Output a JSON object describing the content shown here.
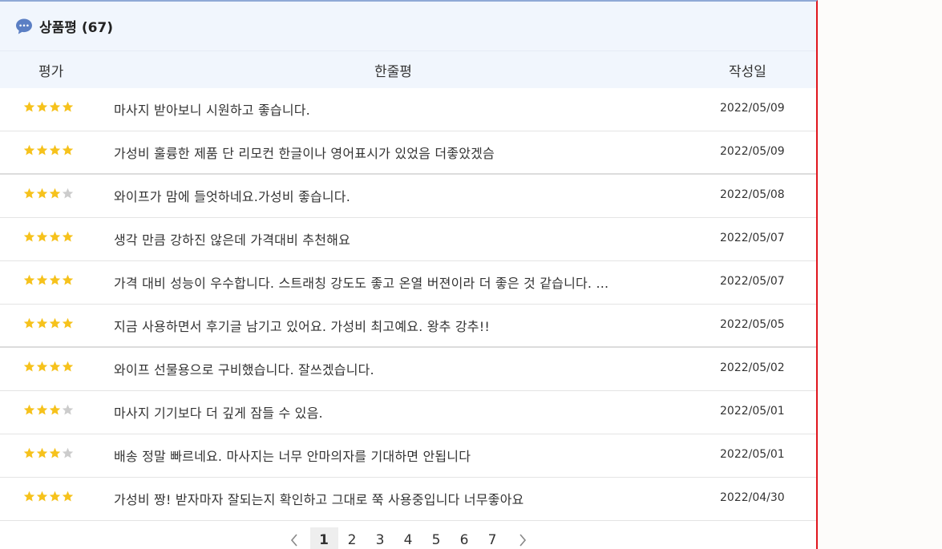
{
  "header": {
    "title": "상품평 (67)",
    "icon": "chat-bubble-icon",
    "accent_color": "#5b7fc4"
  },
  "columns": {
    "rating": "평가",
    "review": "한줄평",
    "date": "작성일"
  },
  "reviews": [
    {
      "stars": 4,
      "text": "마사지 받아보니 시원하고 좋습니다.",
      "date": "2022/05/09"
    },
    {
      "stars": 4,
      "text": "가성비 훌륭한 제품 단 리모컨 한글이나 영어표시가 있었음 더좋았겠슴",
      "date": "2022/05/09"
    },
    {
      "stars": 3,
      "text": "와이프가 맘에 들엇하네요.가성비 좋습니다.",
      "date": "2022/05/08"
    },
    {
      "stars": 4,
      "text": "생각 만큼 강하진 않은데 가격대비 추천해요",
      "date": "2022/05/07"
    },
    {
      "stars": 4,
      "text": "가격 대비 성능이 우수합니다. 스트래칭 강도도 좋고 온열 버젼이라 더 좋은 것 같습니다. ...",
      "date": "2022/05/07"
    },
    {
      "stars": 4,
      "text": "지금 사용하면서 후기글 남기고 있어요. 가성비 최고예요. 왕추 강추!!",
      "date": "2022/05/05"
    },
    {
      "stars": 4,
      "text": "와이프 선물용으로 구비했습니다. 잘쓰겠습니다.",
      "date": "2022/05/02"
    },
    {
      "stars": 3,
      "text": "마사지 기기보다 더 깊게 잠들 수 있음.",
      "date": "2022/05/01"
    },
    {
      "stars": 3,
      "text": "배송 정말 빠르네요. 마사지는 너무 안마의자를 기대하면 안됩니다",
      "date": "2022/05/01"
    },
    {
      "stars": 4,
      "text": "가성비 짱! 받자마자 잘되는지 확인하고 그대로 쭉 사용중입니다 너무좋아요",
      "date": "2022/04/30"
    }
  ],
  "star_colors": {
    "filled": "#f6c21c",
    "empty": "#cccccc"
  },
  "pagination": {
    "pages": [
      "1",
      "2",
      "3",
      "4",
      "5",
      "6",
      "7"
    ],
    "current": "1",
    "prev_icon": "chevron-left-icon",
    "next_icon": "chevron-right-icon"
  }
}
